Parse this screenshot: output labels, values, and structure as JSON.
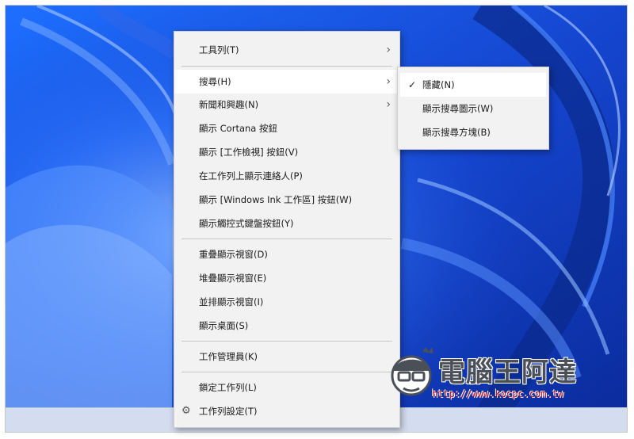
{
  "main_menu": {
    "items": [
      {
        "label": "工具列(T)"
      },
      {
        "label": "搜尋(H)"
      },
      {
        "label": "新聞和興趣(N)"
      },
      {
        "label": "顯示 Cortana 按鈕"
      },
      {
        "label": "顯示 [工作檢視] 按鈕(V)"
      },
      {
        "label": "在工作列上顯示連絡人(P)"
      },
      {
        "label": "顯示 [Windows Ink 工作區] 按鈕(W)"
      },
      {
        "label": "顯示觸控式鍵盤按鈕(Y)"
      },
      {
        "label": "重疊顯示視窗(D)"
      },
      {
        "label": "堆疊顯示視窗(E)"
      },
      {
        "label": "並排顯示視窗(I)"
      },
      {
        "label": "顯示桌面(S)"
      },
      {
        "label": "工作管理員(K)"
      },
      {
        "label": "鎖定工作列(L)"
      },
      {
        "label": "工作列設定(T)"
      }
    ],
    "submenu_arrow": "›",
    "settings_icon": "gear-icon"
  },
  "search_submenu": {
    "items": [
      {
        "label": "隱藏(N)",
        "checked": true
      },
      {
        "label": "顯示搜尋圖示(W)",
        "checked": false
      },
      {
        "label": "顯示搜尋方塊(B)",
        "checked": false
      }
    ],
    "check_glyph": "✓"
  },
  "watermark": {
    "title": "電腦王阿達",
    "url": "http://www.kocpc.com.tw"
  },
  "colors": {
    "menu_bg": "#f2f2f2",
    "hover_bg": "#ffffff",
    "wallpaper_blue": "#1a4fd6"
  }
}
